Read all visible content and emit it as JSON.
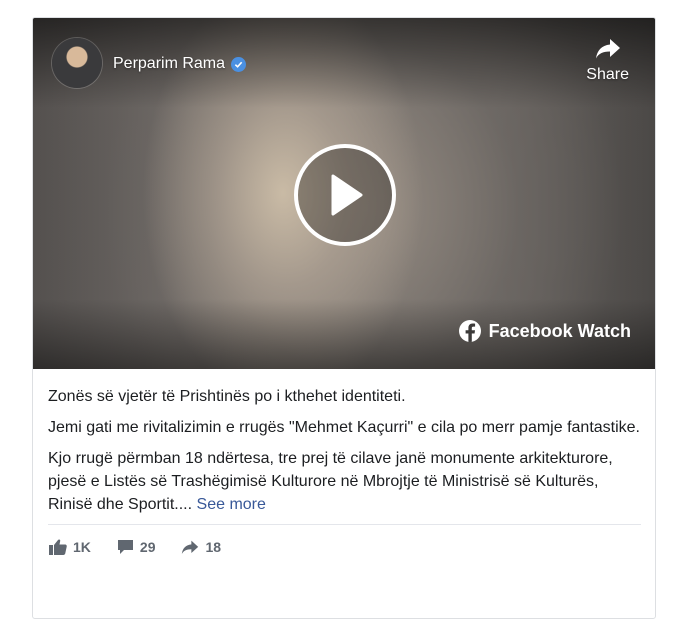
{
  "post": {
    "author_name": "Perparim Rama",
    "share_label": "Share",
    "watch_label": "Facebook Watch",
    "paragraphs": [
      "Zonës së vjetër të Prishtinës po i kthehet identiteti.",
      "Jemi gati me rivitalizimin e rrugës \"Mehmet Kaçurri\" e cila po merr pamje fantastike.",
      "Kjo rrugë përmban 18 ndërtesa, tre prej të cilave janë monumente arkitekturore, pjesë e Listës së Trashëgimisë Kulturore në Mbrojtje të Ministrisë së Kulturës, Rinisë dhe Sportit...."
    ],
    "see_more_label": "See more"
  },
  "stats": {
    "likes": "1K",
    "comments": "29",
    "shares": "18"
  },
  "icons": {
    "avatar": "profile-photo",
    "verified": "verified-badge-icon",
    "share": "share-arrow-icon",
    "play": "play-icon",
    "facebook": "facebook-logo-icon",
    "like": "thumbs-up-icon",
    "comment": "comment-bubble-icon",
    "share_small": "share-arrow-icon"
  },
  "colors": {
    "link": "#385898",
    "verified": "#4a90e2",
    "stat_text": "#606770"
  }
}
